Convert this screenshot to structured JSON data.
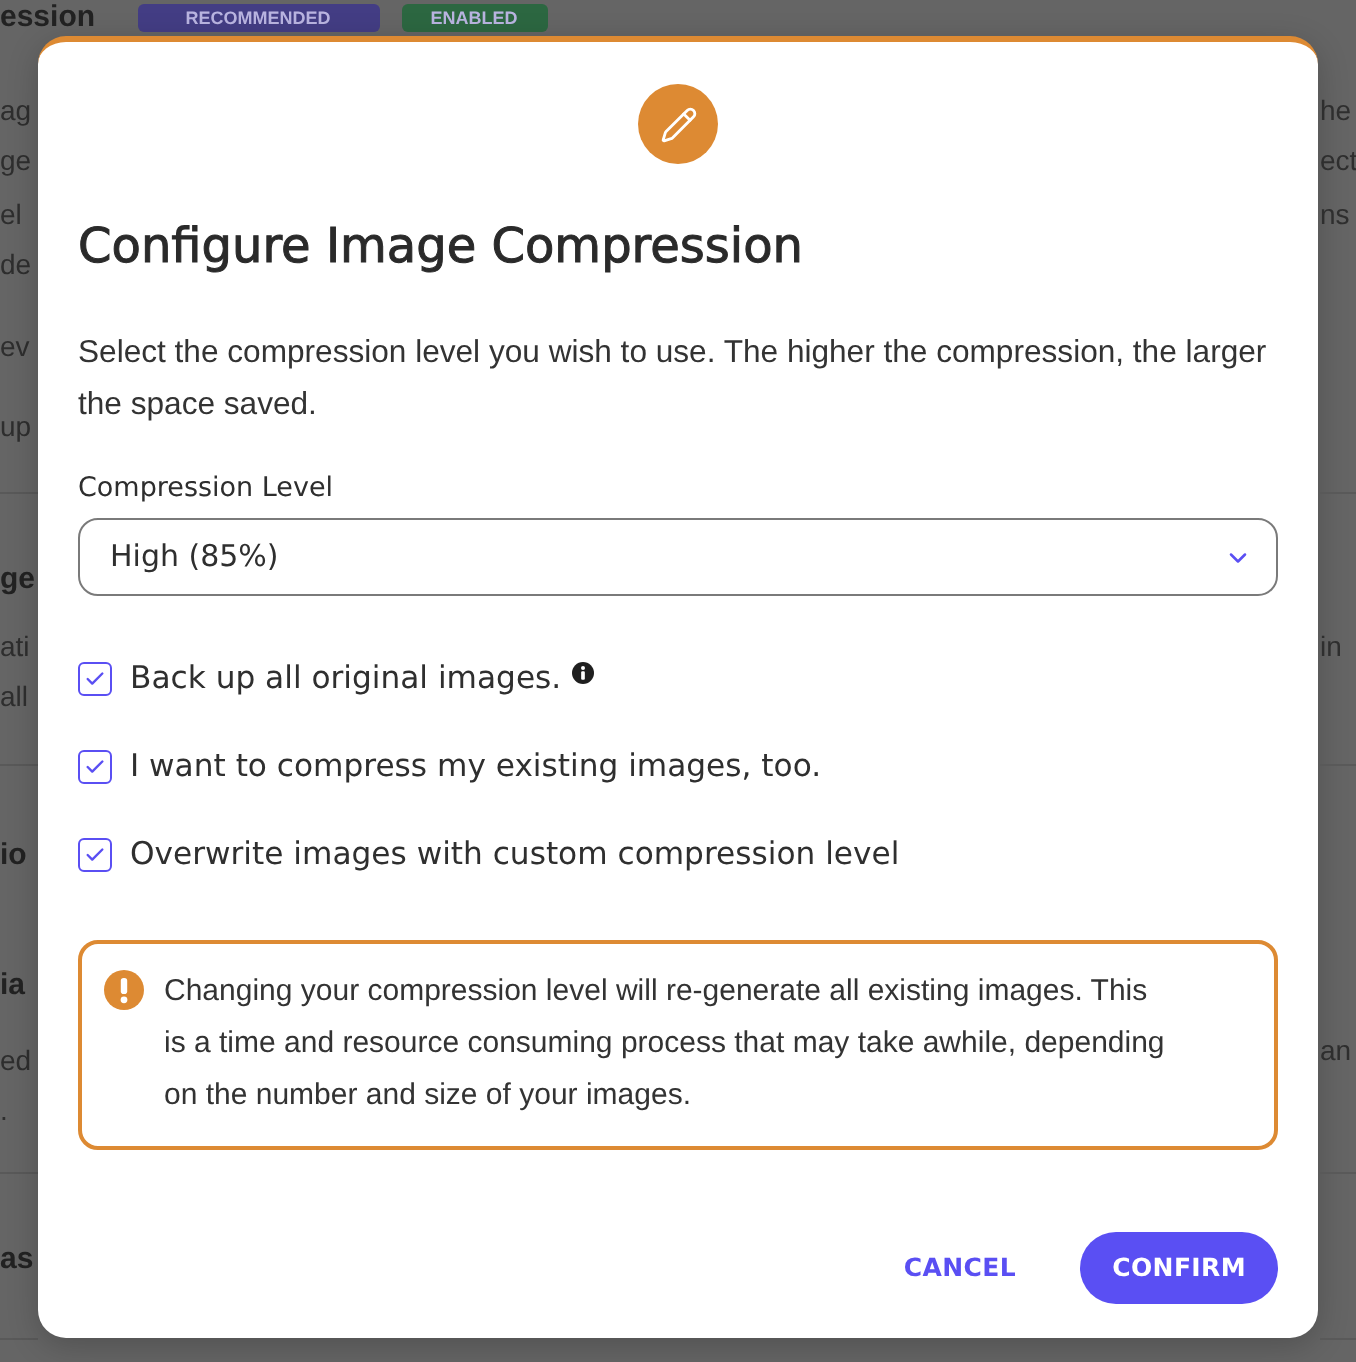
{
  "background": {
    "heading": "ession",
    "badges": [
      {
        "label": "RECOMMENDED",
        "color": "#433d84"
      },
      {
        "label": "ENABLED",
        "color": "#2c6741"
      }
    ],
    "left_edge": [
      {
        "lines": [
          {
            "text": "ag",
            "kind": "text"
          },
          {
            "text": "ge",
            "kind": "text"
          },
          {
            "text": "el",
            "kind": "text"
          },
          {
            "text": "de",
            "kind": "text"
          },
          {
            "text": "ev",
            "kind": "text"
          },
          {
            "text": "up",
            "kind": "text"
          }
        ]
      },
      {
        "lines": [
          {
            "text": "ge",
            "kind": "heading"
          },
          {
            "text": "ati",
            "kind": "text"
          },
          {
            "text": "all",
            "kind": "text"
          }
        ]
      },
      {
        "lines": [
          {
            "text": "io",
            "kind": "heading"
          },
          {
            "text": "ia",
            "kind": "heading"
          },
          {
            "text": "ed",
            "kind": "text"
          },
          {
            "text": ".",
            "kind": "text"
          }
        ]
      },
      {
        "lines": [
          {
            "text": "as",
            "kind": "heading"
          }
        ]
      }
    ],
    "right_edge": [
      {
        "lines": [
          {
            "text": "he",
            "kind": "text"
          },
          {
            "text": "ect",
            "kind": "text"
          },
          {
            "text": "ns",
            "kind": "text"
          }
        ]
      },
      {
        "lines": [
          {
            "text": "in",
            "kind": "text"
          }
        ]
      },
      {
        "lines": [
          {
            "text": "an",
            "kind": "text"
          }
        ]
      }
    ]
  },
  "dialog": {
    "title": "Configure Image Compression",
    "description": "Select the compression level you wish to use. The higher the compression, the larger the space saved.",
    "compression_level": {
      "label": "Compression Level",
      "value": "High (85%)"
    },
    "options": [
      {
        "label": "Back up all original images.",
        "checked": true,
        "info": true
      },
      {
        "label": "I want to compress my existing images, too.",
        "checked": true,
        "info": false
      },
      {
        "label": "Overwrite images with custom compression level",
        "checked": true,
        "info": false
      }
    ],
    "warning": "Changing your compression level will re-generate all existing images. This is a time and resource consuming process that may take awhile, depending on the number and size of your images.",
    "buttons": [
      {
        "label": "CANCEL",
        "kind": "text"
      },
      {
        "label": "CONFIRM",
        "kind": "primary"
      }
    ]
  }
}
